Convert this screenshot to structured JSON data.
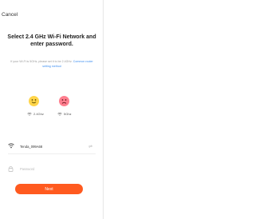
{
  "header": {
    "cancel_label": "Cancel"
  },
  "instructions": {
    "title": "Select 2.4 GHz Wi-Fi Network and enter password.",
    "hint_prefix": "If your Wi-Fi is 5GHz, please set it to be 2.4GHz.",
    "hint_link": "Common router setting method"
  },
  "bands": [
    {
      "label": "2.4Ghz",
      "icon": "wifi-small-icon",
      "status": "happy"
    },
    {
      "label": "5Ghz",
      "icon": "wifi-small-icon",
      "status": "sad"
    }
  ],
  "form": {
    "wifi_name": "Tenda_099A68",
    "wifi_icon": "wifi-icon",
    "menu_icon": "switch-network-icon",
    "password_placeholder": "Password",
    "password_icon": "lock-icon"
  },
  "actions": {
    "next_label": "Next"
  },
  "colors": {
    "accent": "#ff5a1f",
    "link": "#3d8ef0",
    "happy": "#ffd54a",
    "sad": "#ff7f8f"
  }
}
